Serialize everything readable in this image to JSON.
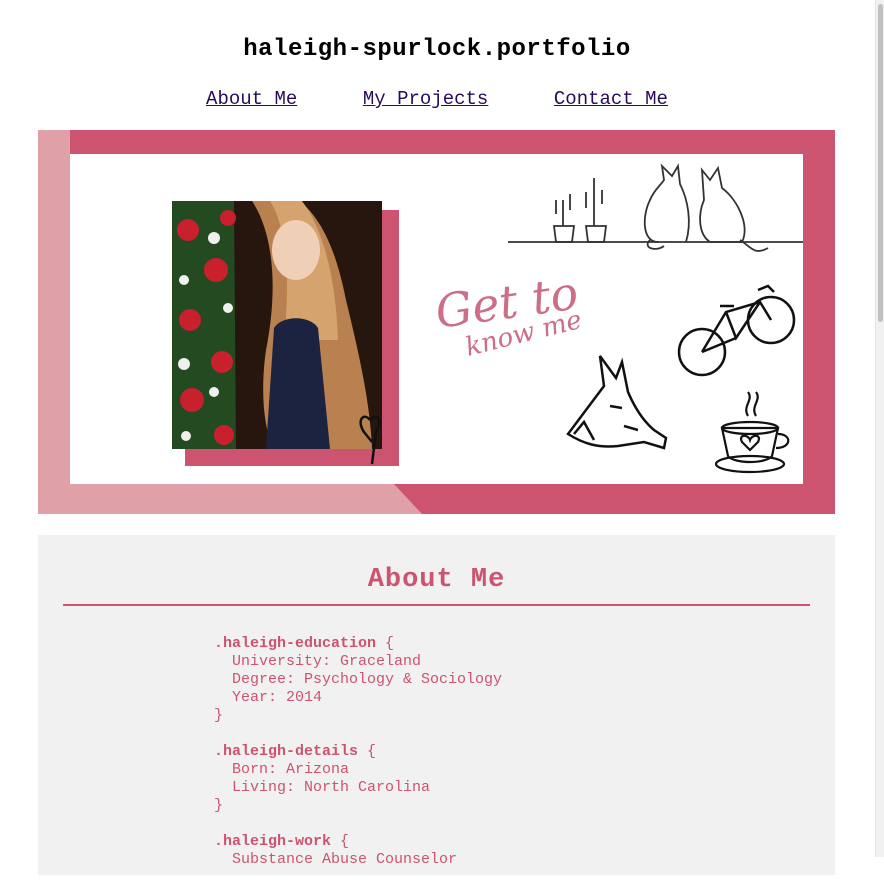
{
  "site": {
    "title": "haleigh-spurlock.portfolio"
  },
  "nav": {
    "items": [
      {
        "label": "About Me"
      },
      {
        "label": "My Projects"
      },
      {
        "label": "Contact Me"
      }
    ]
  },
  "hero": {
    "tagline_line1": "Get to",
    "tagline_line2": "know me",
    "colors": {
      "frame": "#cc5470",
      "frame_light": "#e0a0a8",
      "script": "#cc6e85"
    }
  },
  "about": {
    "title": "About Me",
    "blocks": [
      {
        "selector": ".haleigh-education",
        "props": [
          "University: Graceland",
          "Degree: Psychology & Sociology",
          "Year: 2014"
        ]
      },
      {
        "selector": ".haleigh-details",
        "props": [
          "Born: Arizona",
          "Living: North Carolina"
        ]
      },
      {
        "selector": ".haleigh-work",
        "props": [
          "Substance Abuse Counselor"
        ]
      }
    ]
  },
  "colors": {
    "accent": "#cc5470",
    "link": "#2a0a5a",
    "panel": "#f1f1f1"
  }
}
